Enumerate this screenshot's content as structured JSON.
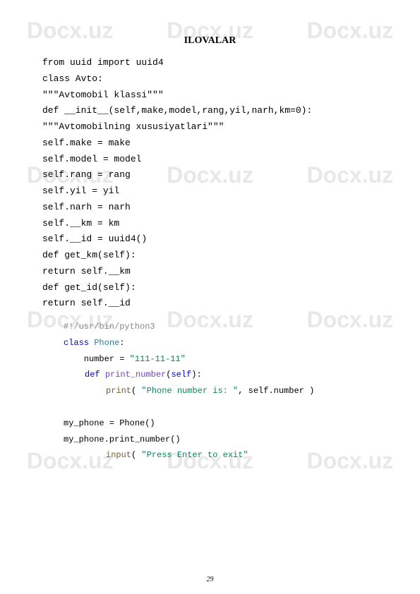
{
  "watermark": "Docx.uz",
  "title": "ILOVALAR",
  "code": [
    "from uuid import uuid4",
    "class Avto:",
    "\"\"\"Avtomobil klassi\"\"\"",
    "def __init__(self,make,model,rang,yil,narh,km=0):",
    "\"\"\"Avtomobilning xususiyatlari\"\"\"",
    "self.make = make",
    "self.model = model",
    "self.rang = rang",
    "self.yil = yil",
    "self.narh = narh",
    "self.__km = km",
    "self.__id = uuid4()",
    "def get_km(self):",
    "return self.__km",
    "def get_id(self):",
    "return self.__id"
  ],
  "py": {
    "shebang": "#!/usr/bin/python3",
    "class_kw": "class",
    "class_name": "Phone",
    "colon": ":",
    "number_assign": "    number = ",
    "number_val": "\"111-11-11\"",
    "def_kw": "def",
    "func_name": "print_number",
    "self_kw": "self",
    "print_fn": "print",
    "print_str": "\"Phone number is: \"",
    "print_tail": ", self.number )",
    "inst1": "my_phone = Phone()",
    "inst2": "my_phone.print_number()",
    "input_fn": "input",
    "input_str": "\"Press Enter to exit\""
  },
  "page_number": "29"
}
